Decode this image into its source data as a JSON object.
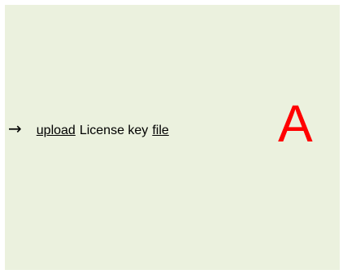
{
  "instruction": {
    "arrow_glyph": "→",
    "upload_word": "upload",
    "middle_text": "License key",
    "file_word": "file"
  },
  "marker": {
    "letter": "A",
    "color": "#ff0000"
  },
  "colors": {
    "panel_background": "#ebf1de"
  }
}
